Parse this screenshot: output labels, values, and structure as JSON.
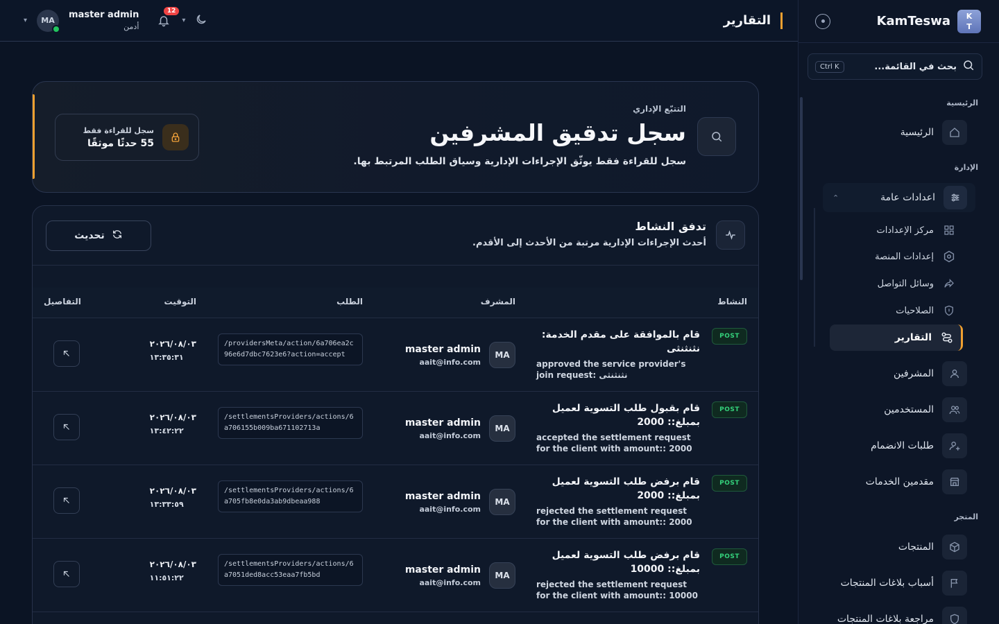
{
  "brand": {
    "logo_top": "K",
    "logo_bottom": "T",
    "name": "KamTeswa"
  },
  "sidebar": {
    "search_placeholder": "بحث في القائمة...",
    "search_shortcut": "Ctrl K",
    "sections": {
      "main": "الرئيسية",
      "admin": "الإدارة",
      "store": "المتجر"
    },
    "home": "الرئيسية",
    "general_settings": "اعدادات عامة",
    "sub_items": {
      "settings_center": "مركز الإعدادات",
      "platform_settings": "إعدادات المنصة",
      "social": "وسائل التواصل",
      "permissions": "الصلاحيات",
      "reports": "التقارير"
    },
    "items": {
      "supervisors": "المشرفين",
      "users": "المستخدمين",
      "join_requests": "طلبات الانضمام",
      "providers": "مقدمين الخدمات",
      "products": "المنتجات",
      "report_reasons": "أسباب بلاغات المنتجات",
      "report_review": "مراجعة بلاغات المنتجات"
    }
  },
  "topbar": {
    "page_title": "التقارير",
    "user_name": "master admin",
    "user_role": "أدمن",
    "avatar": "MA",
    "notifications": "12"
  },
  "hero": {
    "kicker": "التتبّع الإداري",
    "title": "سجل تدقيق المشرفين",
    "subtitle": "سجل للقراءة فقط يوثّق الإجراءات الإدارية وسياق الطلب المرتبط بها.",
    "card_label": "سجل للقراءة فقط",
    "card_value": "55 حدثًا موثقًا"
  },
  "activity": {
    "title": "تدفق النشاط",
    "subtitle": "أحدث الإجراءات الإدارية مرتبة من الأحدث إلى الأقدم.",
    "refresh": "تحديث",
    "columns": {
      "activity": "النشاط",
      "supervisor": "المشرف",
      "request": "الطلب",
      "time": "التوقيت",
      "details": "التفاصيل"
    },
    "rows": [
      {
        "method": "POST",
        "ar": "قام بالموافقة على مقدم الخدمة: نثنثنثى",
        "en": "approved the service provider's join request: نثنثنثى",
        "avatar": "MA",
        "name": "master admin",
        "email": "aait@info.com",
        "request": "/providersMeta/action/6a706ea2c96e6d7dbc7623e6?action=accept",
        "date": "٢٠٢٦/٠٨/٠٣",
        "clock": "١٣:٣٥:٣١"
      },
      {
        "method": "POST",
        "ar": "قام بقبول طلب التسوية لعميل بمبلغ:: 2000",
        "en": "accepted the settlement request for the client with amount:: 2000",
        "avatar": "MA",
        "name": "master admin",
        "email": "aait@info.com",
        "request": "/settlementsProviders/actions/6a706155b009ba671102713a",
        "date": "٢٠٢٦/٠٨/٠٣",
        "clock": "١٣:٤٢:٢٢"
      },
      {
        "method": "POST",
        "ar": "قام برفض طلب التسوية لعميل بمبلغ:: 2000",
        "en": "rejected the settlement request for the client with amount:: 2000",
        "avatar": "MA",
        "name": "master admin",
        "email": "aait@info.com",
        "request": "/settlementsProviders/actions/6a705fb8e0da3ab9dbeaa988",
        "date": "٢٠٢٦/٠٨/٠٣",
        "clock": "١٣:٣٣:٥٩"
      },
      {
        "method": "POST",
        "ar": "قام برفض طلب التسوية لعميل بمبلغ:: 10000",
        "en": "rejected the settlement request for the client with amount:: 10000",
        "avatar": "MA",
        "name": "master admin",
        "email": "aait@info.com",
        "request": "/settlementsProviders/actions/6a7051ded8acc53eaa7fb5bd",
        "date": "٢٠٢٦/٠٨/٠٣",
        "clock": "١١:٥١:٢٢"
      }
    ]
  },
  "colors": {
    "accent": "#f0a030",
    "post": "#34d17b",
    "online": "#22c55e",
    "badge": "#ef4444"
  }
}
